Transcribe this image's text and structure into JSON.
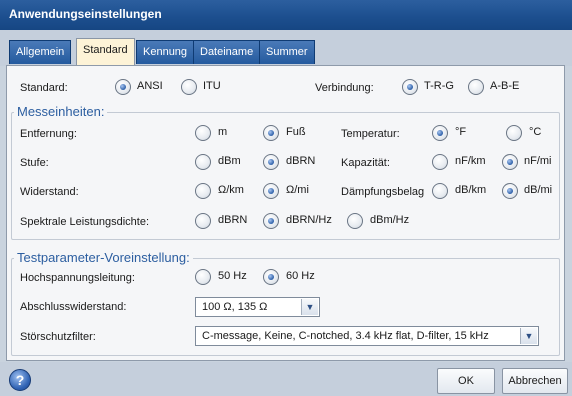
{
  "window": {
    "title": "Anwendungseinstellungen"
  },
  "tabs": [
    "Allgemein",
    "Standard",
    "Kennung",
    "Dateiname",
    "Summer"
  ],
  "active_tab": "Standard",
  "standard": {
    "label": "Standard:",
    "options": [
      "ANSI",
      "ITU"
    ],
    "selected": "ANSI"
  },
  "connection": {
    "label": "Verbindung:",
    "options": [
      "T-R-G",
      "A-B-E"
    ],
    "selected": "T-R-G"
  },
  "units": {
    "title": "Messeinheiten:",
    "distance": {
      "label": "Entfernung:",
      "options": [
        "m",
        "Fuß"
      ],
      "selected": "Fuß"
    },
    "temperature": {
      "label": "Temperatur:",
      "options": [
        "°F",
        "°C"
      ],
      "selected": "°F"
    },
    "level": {
      "label": "Stufe:",
      "options": [
        "dBm",
        "dBRN"
      ],
      "selected": "dBRN"
    },
    "capacitance": {
      "label": "Kapazität:",
      "options": [
        "nF/km",
        "nF/mi"
      ],
      "selected": "nF/mi"
    },
    "resistance": {
      "label": "Widerstand:",
      "options": [
        "Ω/km",
        "Ω/mi"
      ],
      "selected": "Ω/mi"
    },
    "attenuation": {
      "label": "Dämpfungsbelag",
      "options": [
        "dB/km",
        "dB/mi"
      ],
      "selected": "dB/mi"
    },
    "psd": {
      "label": "Spektrale Leistungsdichte:",
      "options": [
        "dBRN",
        "dBRN/Hz",
        "dBm/Hz"
      ],
      "selected": "dBRN/Hz"
    }
  },
  "test_params": {
    "title": "Testparameter-Voreinstellung:",
    "power_line": {
      "label": "Hochspannungsleitung:",
      "options": [
        "50 Hz",
        "60 Hz"
      ],
      "selected": "60 Hz"
    },
    "termination": {
      "label": "Abschlusswiderstand:",
      "value": "100 Ω, 135 Ω"
    },
    "noise_filter": {
      "label": "Störschutzfilter:",
      "value": "C-message, Keine, C-notched, 3.4 kHz flat, D-filter, 15 kHz"
    }
  },
  "buttons": {
    "help": "?",
    "ok": "OK",
    "cancel": "Abbrechen"
  },
  "icons": {
    "help": "help-icon",
    "dropdown": "chevron-down-icon"
  },
  "colors": {
    "title_bar": "#1d4f8f",
    "tab": "#245a9e",
    "active_tab": "#fdf3d7",
    "group_title": "#2c5ea0"
  }
}
